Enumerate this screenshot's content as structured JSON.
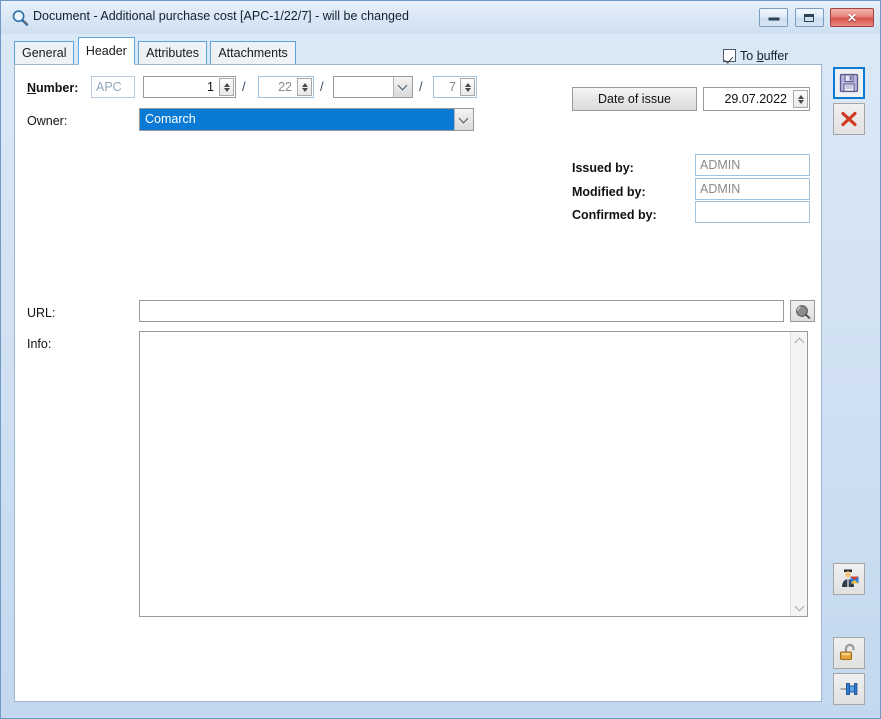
{
  "window": {
    "title": "Document - Additional purchase cost [APC-1/22/7]  - will be changed",
    "icon": "document-preview-magnifier-icon",
    "controls": {
      "minimize_label": "Minimize",
      "maximize_label": "Maximize",
      "close_label": "Close",
      "close_glyph": "✕"
    }
  },
  "tabs": [
    {
      "label": "General",
      "active": false
    },
    {
      "label": "Header",
      "active": true
    },
    {
      "label": "Attributes",
      "active": false
    },
    {
      "label": "Attachments",
      "active": false
    }
  ],
  "to_buffer": {
    "label_pre": "To ",
    "label_accel": "b",
    "label_post": "uffer",
    "checked": true
  },
  "form": {
    "number": {
      "label_accel": "N",
      "label_rest": "umber:",
      "prefix_value": "APC",
      "series_value": "1",
      "year_value": "22",
      "extra_value": "",
      "counter_value": "7",
      "separator": "/"
    },
    "owner": {
      "label": "Owner:",
      "value": "Comarch"
    },
    "date_of_issue": {
      "button_label": "Date of issue",
      "value": "29.07.2022"
    },
    "issued_by": {
      "label": "Issued by:",
      "value": "ADMIN"
    },
    "modified_by": {
      "label": "Modified by:",
      "value": "ADMIN"
    },
    "confirmed_by": {
      "label": "Confirmed by:",
      "value": ""
    },
    "url": {
      "label": "URL:",
      "value": "",
      "browse_icon": "url-magnifier-icon"
    },
    "info": {
      "label": "Info:",
      "value": ""
    }
  },
  "toolbar": [
    {
      "name": "save-button",
      "icon": "floppy-disk-save-icon",
      "focused": true
    },
    {
      "name": "close-button",
      "icon": "red-x-close-icon",
      "focused": false
    },
    {
      "name": "contractor-button",
      "icon": "person-contractor-icon",
      "focused": false
    },
    {
      "name": "unlock-button",
      "icon": "open-padlock-icon",
      "focused": false
    },
    {
      "name": "pin-button",
      "icon": "blue-pin-icon",
      "focused": false
    }
  ],
  "colors": {
    "accent": "#0a7ad4",
    "tab_border": "#5ba3dd",
    "close_red": "#d9534a",
    "frame": "#6f9ac8"
  }
}
